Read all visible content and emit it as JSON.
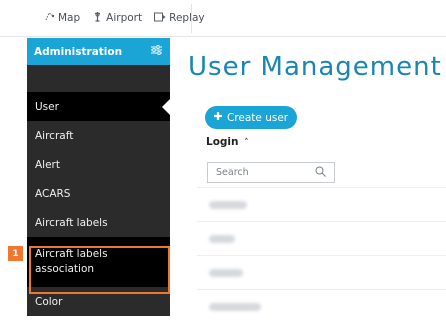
{
  "topbar": {
    "items": [
      {
        "icon": "map-pin-icon",
        "label": "Map"
      },
      {
        "icon": "airport-icon",
        "label": "Airport"
      },
      {
        "icon": "replay-icon",
        "label": "Replay"
      }
    ]
  },
  "sidebar": {
    "header": "Administration",
    "items": [
      {
        "label": "User",
        "active": true
      },
      {
        "label": "Aircraft"
      },
      {
        "label": "Alert"
      },
      {
        "label": "ACARS"
      },
      {
        "label": "Aircraft labels"
      },
      {
        "label": "Aircraft labels association",
        "highlighted": true
      },
      {
        "label": "Color"
      }
    ]
  },
  "annotation": {
    "badge": "1"
  },
  "main": {
    "title": "User Management",
    "create_button": "Create user",
    "column_header": "Login",
    "sort_indicator": "˄",
    "search_placeholder": "Search"
  },
  "colors": {
    "accent": "#1aa5d6",
    "title": "#1a86b4",
    "sidebar_bg": "#2b2b2b",
    "highlight": "#f07730"
  }
}
